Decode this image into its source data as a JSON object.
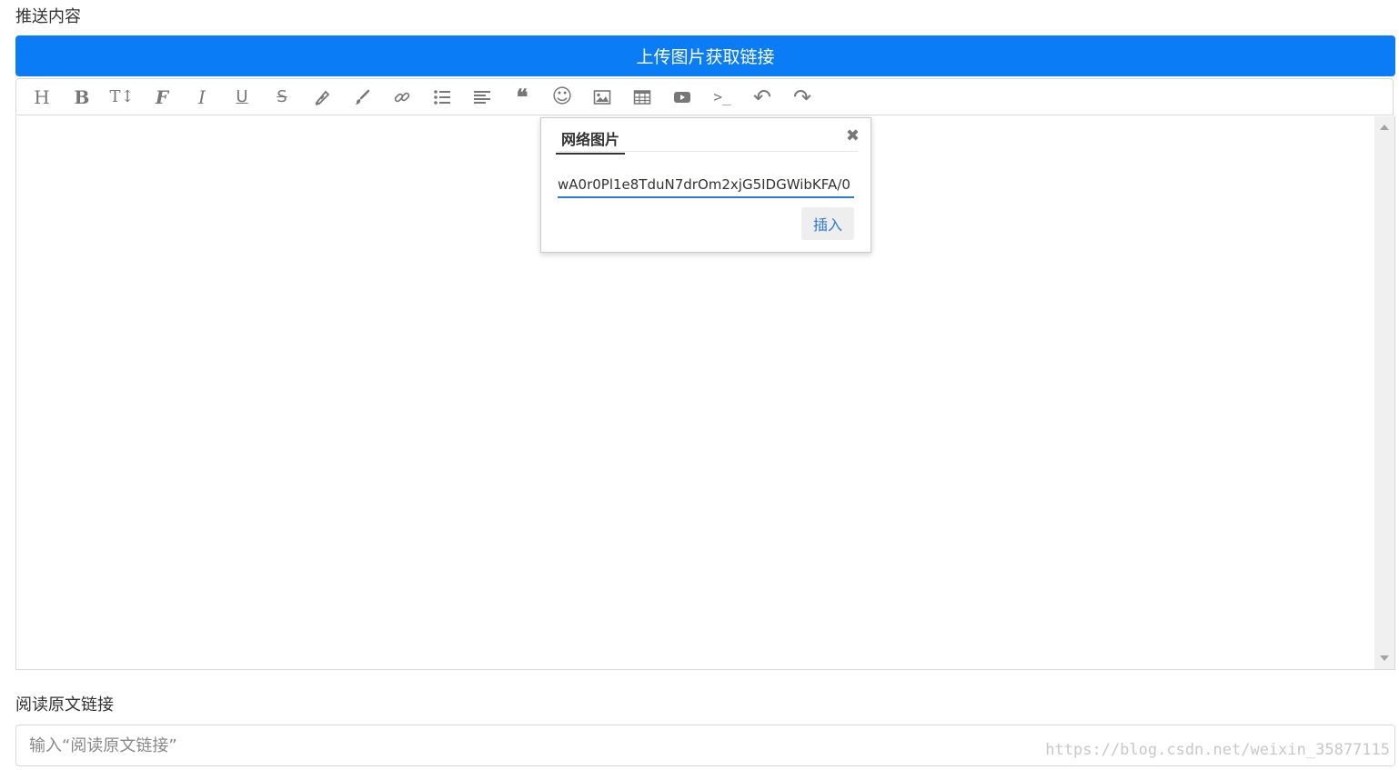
{
  "sections": {
    "content_label": "推送内容",
    "link_label": "阅读原文链接"
  },
  "upload": {
    "label": "上传图片获取链接",
    "color": "#0a7cf6"
  },
  "toolbar": {
    "items": [
      {
        "name": "heading-icon",
        "text": "H"
      },
      {
        "name": "bold-icon",
        "text": "B"
      },
      {
        "name": "text-size-icon",
        "text": "T↕"
      },
      {
        "name": "font-icon",
        "text": "F"
      },
      {
        "name": "italic-icon",
        "text": "I"
      },
      {
        "name": "underline-icon",
        "text": "U"
      },
      {
        "name": "strikethrough-icon",
        "text": "S"
      },
      {
        "name": "highlighter-icon"
      },
      {
        "name": "brush-icon"
      },
      {
        "name": "link-icon"
      },
      {
        "name": "list-icon"
      },
      {
        "name": "align-icon"
      },
      {
        "name": "quote-icon",
        "text": "❝"
      },
      {
        "name": "emoji-icon",
        "text": "☺"
      },
      {
        "name": "image-icon"
      },
      {
        "name": "table-icon"
      },
      {
        "name": "video-icon"
      },
      {
        "name": "code-icon",
        "text": ">_"
      },
      {
        "name": "undo-icon",
        "text": "↶"
      },
      {
        "name": "redo-icon",
        "text": "↷"
      }
    ]
  },
  "popover": {
    "tab": "网络图片",
    "close": "✖",
    "url_value": "wA0r0Pl1e8TduN7drOm2xjG5IDGWibKFA/0",
    "insert_label": "插入"
  },
  "link_input": {
    "placeholder": "输入“阅读原文链接”"
  },
  "watermark": "https://blog.csdn.net/weixin_35877115"
}
